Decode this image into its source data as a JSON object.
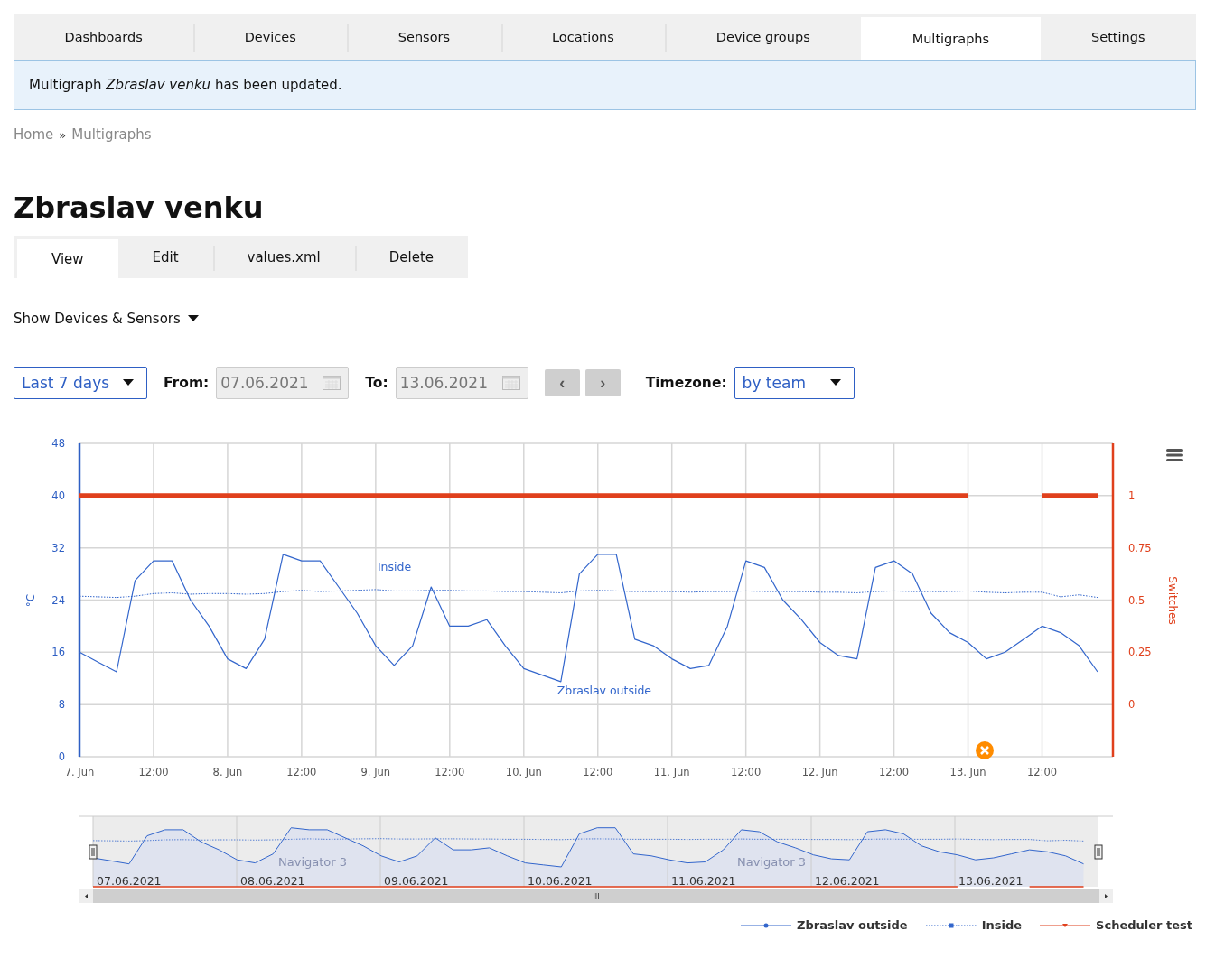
{
  "nav_tabs": [
    {
      "label": "Dashboards",
      "selected": false
    },
    {
      "label": "Devices",
      "selected": false
    },
    {
      "label": "Sensors",
      "selected": false
    },
    {
      "label": "Locations",
      "selected": false
    },
    {
      "label": "Device groups",
      "selected": false
    },
    {
      "label": "Multigraphs",
      "selected": true
    },
    {
      "label": "Settings",
      "selected": false
    }
  ],
  "alert": {
    "text": "Multigraph *Zbraslav venku* has been updated."
  },
  "breadcrumb": [
    "Home",
    "Multigraphs"
  ],
  "breadcrumb_separator": "»",
  "title": "Zbraslav venku",
  "sub_tabs": [
    {
      "label": "View",
      "selected": true
    },
    {
      "label": "Edit",
      "selected": false
    },
    {
      "label": "values.xml",
      "selected": false
    },
    {
      "label": "Delete",
      "selected": false
    }
  ],
  "toggle": {
    "label": "Show Devices & Sensors",
    "expanded": false
  },
  "controls": {
    "range": "Last 7 days",
    "from_label": "From:",
    "from": "07.06.2021",
    "to_label": "To:",
    "to": "13.06.2021",
    "prev": "‹",
    "next": "›",
    "timezone_label": "Timezone:",
    "timezone": "by team"
  },
  "chart": {
    "chart_data": {
      "type": "line",
      "ylabel": "°C",
      "y2label": "Switches",
      "ylim": [
        0,
        48
      ],
      "y2lim": [
        -0.25,
        1.25
      ],
      "grid": true,
      "categories": [
        "7. Jun",
        null,
        null,
        null,
        "12:00",
        null,
        null,
        null,
        "8. Jun",
        null,
        null,
        null,
        "12:00",
        null,
        null,
        null,
        "9. Jun",
        null,
        null,
        null,
        "12:00",
        null,
        null,
        null,
        "10. Jun",
        null,
        null,
        null,
        "12:00",
        null,
        null,
        null,
        "11. Jun",
        null,
        null,
        null,
        "12:00",
        null,
        null,
        null,
        "12. Jun",
        null,
        null,
        null,
        "12:00",
        null,
        null,
        null,
        "13. Jun",
        null,
        null,
        null,
        "12:00",
        null,
        null,
        null
      ],
      "yticks": [
        0,
        8,
        16,
        24,
        32,
        40,
        48
      ],
      "y2ticks": [
        0,
        0.25,
        0.5,
        0.75,
        1
      ],
      "series": [
        {
          "name": "Zbraslav outside",
          "color": "#3366cc",
          "line_style": "solid",
          "values": [
            16,
            14.5,
            13,
            27,
            30,
            30,
            24,
            20,
            15,
            13.5,
            18,
            31,
            30,
            30,
            26,
            22,
            17,
            14,
            17,
            26,
            20,
            20,
            21,
            17,
            13.5,
            12.5,
            11.5,
            28,
            31,
            31,
            18,
            17,
            15,
            13.5,
            14,
            20,
            30,
            29,
            24,
            21,
            17.5,
            15.5,
            15,
            29,
            30,
            28,
            22,
            19,
            17.5,
            15,
            16,
            18,
            20,
            19,
            17,
            13
          ]
        },
        {
          "name": "Inside",
          "color": "#3366cc",
          "line_style": "dotted",
          "values": [
            24.6,
            24.5,
            24.4,
            24.6,
            25,
            25.1,
            24.9,
            25,
            25,
            24.9,
            25,
            25.3,
            25.5,
            25.3,
            25.4,
            25.5,
            25.6,
            25.4,
            25.4,
            25.5,
            25.5,
            25.4,
            25.4,
            25.3,
            25.3,
            25.2,
            25.1,
            25.4,
            25.5,
            25.4,
            25.3,
            25.3,
            25.3,
            25.2,
            25.3,
            25.3,
            25.4,
            25.3,
            25.3,
            25.3,
            25.2,
            25.2,
            25.1,
            25.3,
            25.4,
            25.3,
            25.3,
            25.3,
            25.4,
            25.2,
            25.1,
            25.2,
            25.2,
            24.5,
            24.8,
            24.4
          ]
        },
        {
          "name": "Scheduler test",
          "color": "#e0401c",
          "line_style": "solid",
          "axis": "y2",
          "values": [
            1,
            1,
            1,
            1,
            1,
            1,
            1,
            1,
            1,
            1,
            1,
            1,
            1,
            1,
            1,
            1,
            1,
            1,
            1,
            1,
            1,
            1,
            1,
            1,
            1,
            1,
            1,
            1,
            1,
            1,
            1,
            1,
            1,
            1,
            1,
            1,
            1,
            1,
            1,
            1,
            1,
            1,
            1,
            1,
            1,
            1,
            1,
            1,
            1,
            null,
            null,
            null,
            1,
            1,
            1,
            1
          ]
        }
      ]
    },
    "line_labels": [
      "Inside",
      "Zbraslav outside"
    ]
  },
  "navigator": {
    "dates": [
      "07.06.2021",
      "08.06.2021",
      "09.06.2021",
      "10.06.2021",
      "11.06.2021",
      "12.06.2021",
      "13.06.2021"
    ],
    "series_labels": [
      "Navigator 3",
      "Navigator 3"
    ],
    "scroll_grip": "III"
  }
}
